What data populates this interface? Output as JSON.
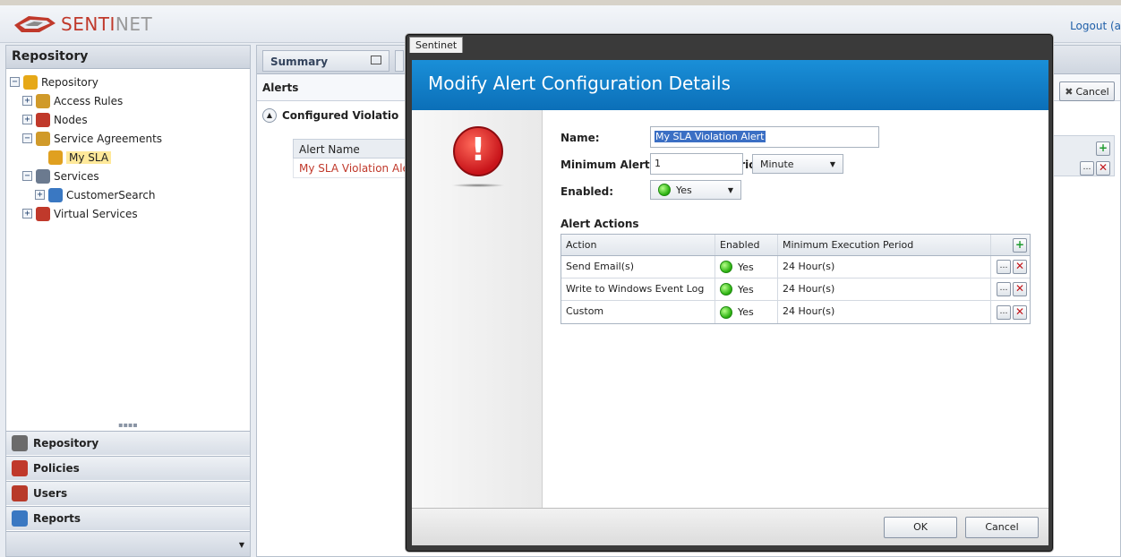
{
  "header": {
    "brand_part1": "SENTI",
    "brand_part2": "NET",
    "logout_label": "Logout (a"
  },
  "left_panel": {
    "title": "Repository",
    "tree": [
      {
        "label": "Repository",
        "icon": "repository-folder-icon",
        "expander": "−",
        "indent": 0
      },
      {
        "label": "Access Rules",
        "icon": "access-rules-icon",
        "expander": "+",
        "indent": 1
      },
      {
        "label": "Nodes",
        "icon": "nodes-icon",
        "expander": "+",
        "indent": 1
      },
      {
        "label": "Service Agreements",
        "icon": "service-agreements-icon",
        "expander": "−",
        "indent": 1
      },
      {
        "label": "My SLA",
        "icon": "sla-icon",
        "expander": "",
        "indent": 2,
        "selected": true
      },
      {
        "label": "Services",
        "icon": "services-gear-icon",
        "expander": "−",
        "indent": 1
      },
      {
        "label": "CustomerSearch",
        "icon": "service-icon",
        "expander": "+",
        "indent": 2
      },
      {
        "label": "Virtual Services",
        "icon": "virtual-services-icon",
        "expander": "+",
        "indent": 1
      }
    ],
    "nav": [
      {
        "label": "Repository",
        "icon": "repository-nav-icon"
      },
      {
        "label": "Policies",
        "icon": "policies-nav-icon"
      },
      {
        "label": "Users",
        "icon": "users-nav-icon"
      },
      {
        "label": "Reports",
        "icon": "reports-nav-icon"
      }
    ]
  },
  "main": {
    "tab_summary": "Summary",
    "alerts_header": "Alerts",
    "configured_label": "Configured Violatio",
    "grid_header": "Alert Name",
    "grid_row": "My SLA Violation Aler",
    "cancel_label": "Cancel"
  },
  "dialog": {
    "window_title": "Sentinet",
    "banner": "Modify Alert Configuration Details",
    "name_label": "Name:",
    "name_value": "My SLA Violation Alert",
    "period_label": "Minimum Alert Generation Period:",
    "period_value": "1",
    "period_unit": "Minute",
    "enabled_label": "Enabled:",
    "enabled_value": "Yes",
    "alert_actions_title": "Alert Actions",
    "columns": {
      "action": "Action",
      "enabled": "Enabled",
      "period": "Minimum Execution Period"
    },
    "actions": [
      {
        "action": "Send Email(s)",
        "enabled": "Yes",
        "period": "24 Hour(s)"
      },
      {
        "action": "Write to Windows Event Log",
        "enabled": "Yes",
        "period": "24 Hour(s)"
      },
      {
        "action": "Custom",
        "enabled": "Yes",
        "period": "24 Hour(s)"
      }
    ],
    "ok_label": "OK",
    "cancel_label": "Cancel"
  },
  "colors": {
    "banner_blue": "#0b6fb8",
    "alert_red": "#c8141a",
    "link_blue": "#1f5fa8",
    "status_green": "#2fb414"
  }
}
